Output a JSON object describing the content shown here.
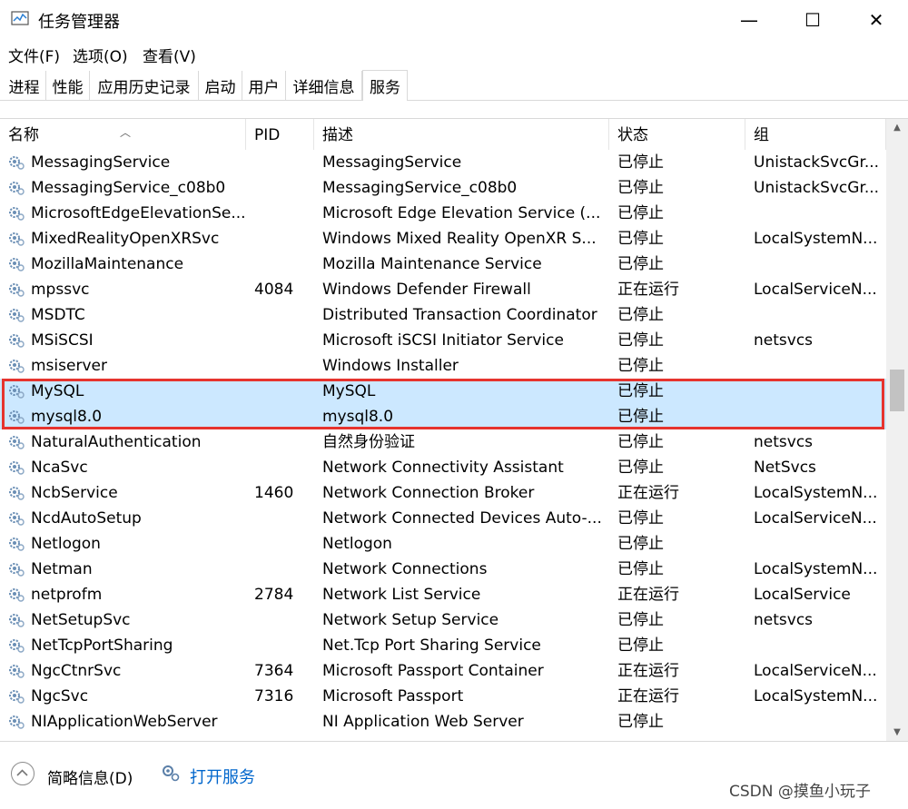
{
  "window": {
    "title": "任务管理器",
    "controls": {
      "minimize": "—",
      "maximize": "☐",
      "close": "✕"
    }
  },
  "menu": [
    "文件(F)",
    "选项(O)",
    "查看(V)"
  ],
  "tabs": [
    "进程",
    "性能",
    "应用历史记录",
    "启动",
    "用户",
    "详细信息",
    "服务"
  ],
  "active_tab": "服务",
  "columns": [
    "名称",
    "PID",
    "描述",
    "状态",
    "组"
  ],
  "rows": [
    {
      "name": "MessagingService",
      "pid": "",
      "desc": "MessagingService",
      "status": "已停止",
      "group": "UnistackSvcGr..."
    },
    {
      "name": "MessagingService_c08b0",
      "pid": "",
      "desc": "MessagingService_c08b0",
      "status": "已停止",
      "group": "UnistackSvcGr..."
    },
    {
      "name": "MicrosoftEdgeElevationSe...",
      "pid": "",
      "desc": "Microsoft Edge Elevation Service (...",
      "status": "已停止",
      "group": ""
    },
    {
      "name": "MixedRealityOpenXRSvc",
      "pid": "",
      "desc": "Windows Mixed Reality OpenXR S...",
      "status": "已停止",
      "group": "LocalSystemN..."
    },
    {
      "name": "MozillaMaintenance",
      "pid": "",
      "desc": "Mozilla Maintenance Service",
      "status": "已停止",
      "group": ""
    },
    {
      "name": "mpssvc",
      "pid": "4084",
      "desc": "Windows Defender Firewall",
      "status": "正在运行",
      "group": "LocalServiceN..."
    },
    {
      "name": "MSDTC",
      "pid": "",
      "desc": "Distributed Transaction Coordinator",
      "status": "已停止",
      "group": ""
    },
    {
      "name": "MSiSCSI",
      "pid": "",
      "desc": "Microsoft iSCSI Initiator Service",
      "status": "已停止",
      "group": "netsvcs"
    },
    {
      "name": "msiserver",
      "pid": "",
      "desc": "Windows Installer",
      "status": "已停止",
      "group": ""
    },
    {
      "name": "MySQL",
      "pid": "",
      "desc": "MySQL",
      "status": "已停止",
      "group": ""
    },
    {
      "name": "mysql8.0",
      "pid": "",
      "desc": "mysql8.0",
      "status": "已停止",
      "group": ""
    },
    {
      "name": "NaturalAuthentication",
      "pid": "",
      "desc": "自然身份验证",
      "status": "已停止",
      "group": "netsvcs"
    },
    {
      "name": "NcaSvc",
      "pid": "",
      "desc": "Network Connectivity Assistant",
      "status": "已停止",
      "group": "NetSvcs"
    },
    {
      "name": "NcbService",
      "pid": "1460",
      "desc": "Network Connection Broker",
      "status": "正在运行",
      "group": "LocalSystemN..."
    },
    {
      "name": "NcdAutoSetup",
      "pid": "",
      "desc": "Network Connected Devices Auto-...",
      "status": "已停止",
      "group": "LocalServiceN..."
    },
    {
      "name": "Netlogon",
      "pid": "",
      "desc": "Netlogon",
      "status": "已停止",
      "group": ""
    },
    {
      "name": "Netman",
      "pid": "",
      "desc": "Network Connections",
      "status": "已停止",
      "group": "LocalSystemN..."
    },
    {
      "name": "netprofm",
      "pid": "2784",
      "desc": "Network List Service",
      "status": "正在运行",
      "group": "LocalService"
    },
    {
      "name": "NetSetupSvc",
      "pid": "",
      "desc": "Network Setup Service",
      "status": "已停止",
      "group": "netsvcs"
    },
    {
      "name": "NetTcpPortSharing",
      "pid": "",
      "desc": "Net.Tcp Port Sharing Service",
      "status": "已停止",
      "group": ""
    },
    {
      "name": "NgcCtnrSvc",
      "pid": "7364",
      "desc": "Microsoft Passport Container",
      "status": "正在运行",
      "group": "LocalServiceN..."
    },
    {
      "name": "NgcSvc",
      "pid": "7316",
      "desc": "Microsoft Passport",
      "status": "正在运行",
      "group": "LocalSystemN..."
    },
    {
      "name": "NIApplicationWebServer",
      "pid": "",
      "desc": "NI Application Web Server",
      "status": "已停止",
      "group": ""
    }
  ],
  "highlighted_rows": [
    "MySQL",
    "mysql8.0"
  ],
  "footer": {
    "fewer_details": "简略信息(D)",
    "open_services": "打开服务"
  },
  "watermark": "CSDN @摸鱼小玩子",
  "colors": {
    "selected_row": "#cce8ff",
    "highlight_border": "#e6342e",
    "link": "#0066cc"
  }
}
